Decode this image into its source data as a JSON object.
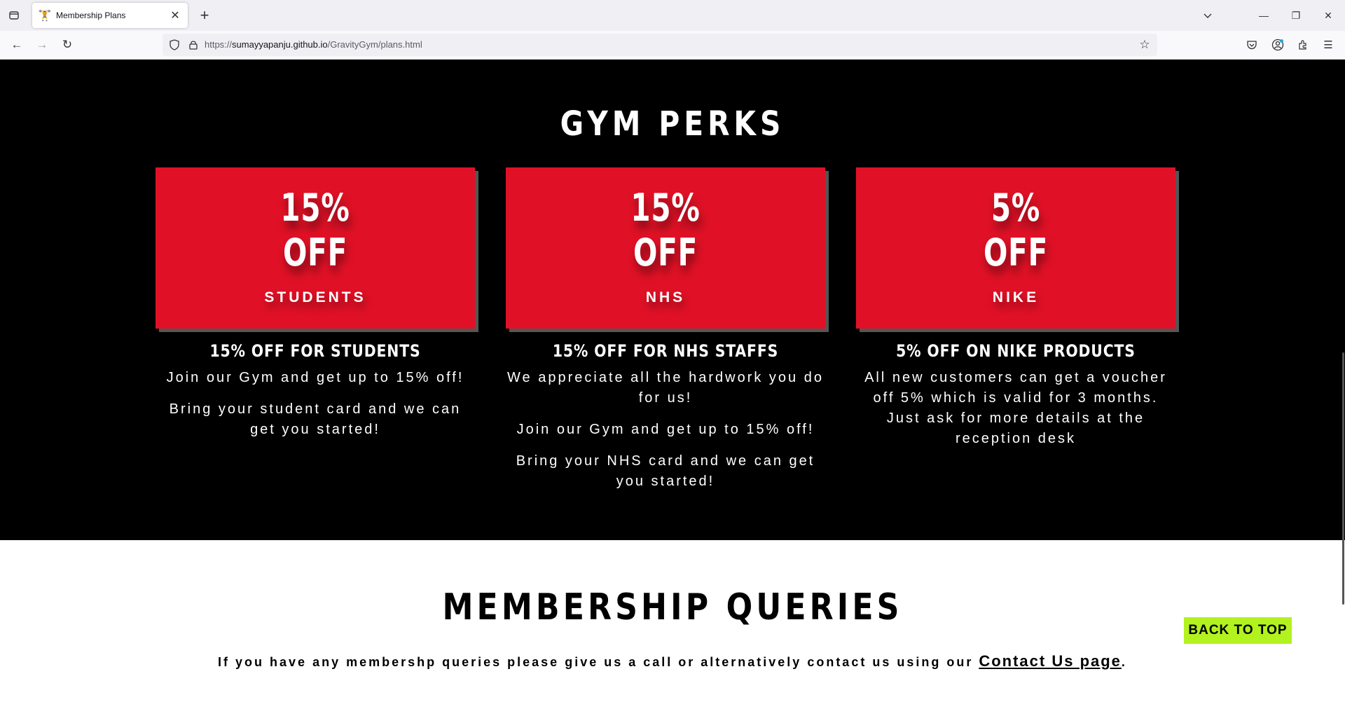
{
  "browser": {
    "tab_title": "Membership Plans",
    "url_prefix": "https://",
    "url_host": "sumayyapanju.github.io",
    "url_path": "/GravityGym/plans.html"
  },
  "perks": {
    "heading": "GYM PERKS",
    "cards": [
      {
        "percent": "15%",
        "off": "OFF",
        "who": "STUDENTS",
        "title": "15% OFF FOR STUDENTS",
        "paragraphs": [
          "Join our Gym and get up to 15% off!",
          "Bring your student card and we can get you started!"
        ]
      },
      {
        "percent": "15%",
        "off": "OFF",
        "who": "NHS",
        "title": "15% OFF FOR NHS STAFFS",
        "paragraphs": [
          "We appreciate all the hardwork you do for us!",
          "Join our Gym and get up to 15% off!",
          "Bring your NHS card and we can get you started!"
        ]
      },
      {
        "percent": "5%",
        "off": "OFF",
        "who": "NIKE",
        "title": "5% OFF ON NIKE PRODUCTS",
        "paragraphs": [
          "All new customers can get a voucher off 5% which is valid for 3 months. Just ask for more details at the reception desk"
        ]
      }
    ]
  },
  "queries": {
    "heading": "MEMBERSHIP QUERIES",
    "text": "If you have any membershp queries please give us a call or alternatively contact us using our ",
    "link": "Contact Us page",
    "end": "."
  },
  "back_to_top": "BACK TO TOP",
  "colors": {
    "card_red": "#e01126",
    "back_to_top_green": "#b2f21f"
  }
}
